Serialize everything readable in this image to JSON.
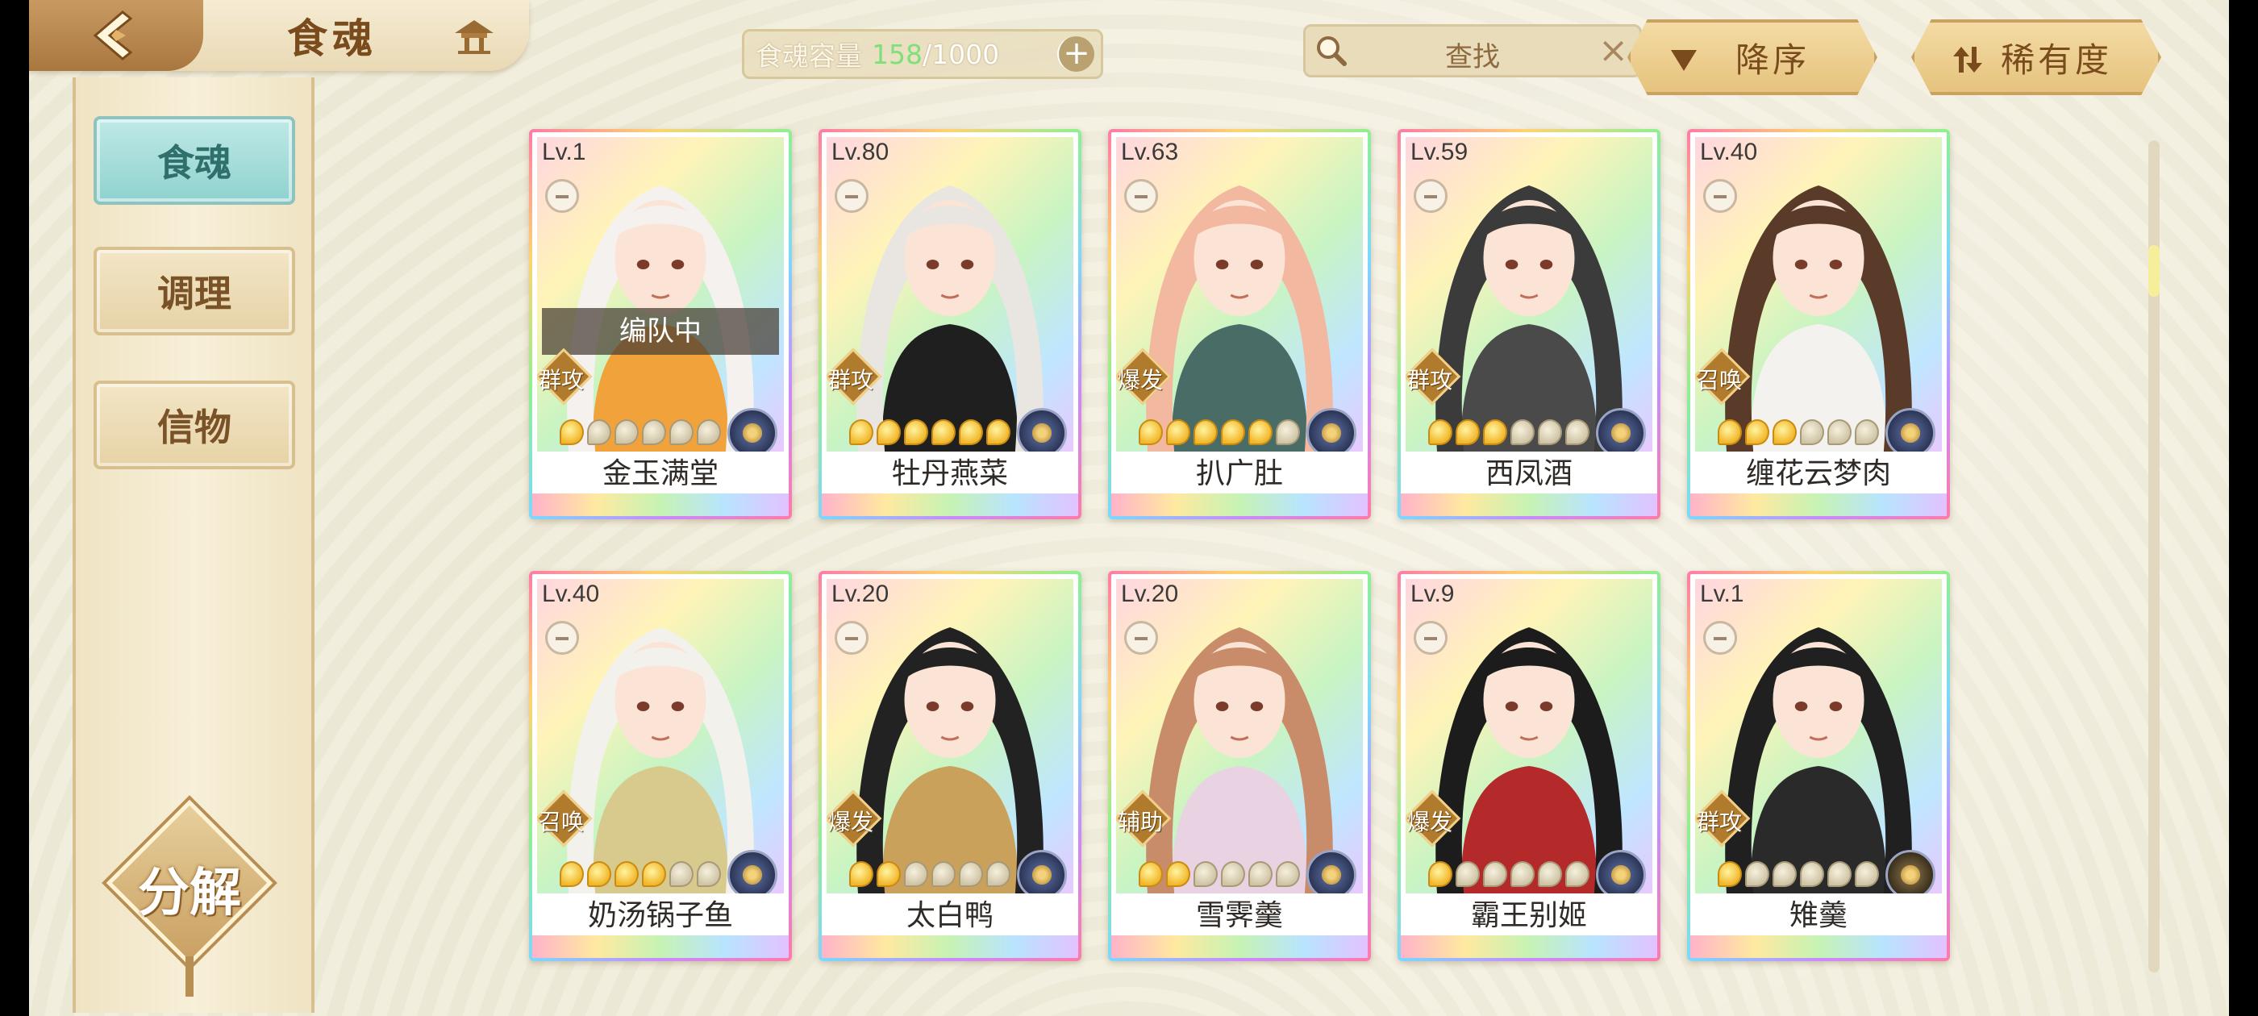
{
  "header": {
    "title": "食魂",
    "capacity": {
      "label": "食魂容量",
      "current": "158",
      "max": "/1000"
    },
    "search": {
      "placeholder": "查找"
    },
    "sort_label": "降序",
    "rarity_label": "稀有度"
  },
  "sidebar": {
    "items": [
      {
        "label": "食魂",
        "active": true
      },
      {
        "label": "调理",
        "active": false
      },
      {
        "label": "信物",
        "active": false
      }
    ],
    "decompose_label": "分解"
  },
  "cards": [
    {
      "level": "Lv.1",
      "name": "金玉满堂",
      "role": "群攻",
      "stars": 1,
      "team_status": "编队中",
      "hair": "#f4f1ef",
      "robe": "#f2a23a",
      "elem": "blue"
    },
    {
      "level": "Lv.80",
      "name": "牡丹燕菜",
      "role": "群攻",
      "stars": 6,
      "team_status": "",
      "hair": "#e9e6e2",
      "robe": "#1f1f1f",
      "elem": "blue"
    },
    {
      "level": "Lv.63",
      "name": "扒广肚",
      "role": "爆发",
      "stars": 5,
      "team_status": "",
      "hair": "#f2b8a0",
      "robe": "#4a6c66",
      "elem": "blue"
    },
    {
      "level": "Lv.59",
      "name": "西凤酒",
      "role": "群攻",
      "stars": 3,
      "team_status": "",
      "hair": "#3b3b3b",
      "robe": "#4a4a4a",
      "elem": "blue"
    },
    {
      "level": "Lv.40",
      "name": "缠花云梦肉",
      "role": "召唤",
      "stars": 3,
      "team_status": "",
      "hair": "#5a3a28",
      "robe": "#f4f2ee",
      "elem": "blue"
    },
    {
      "level": "Lv.40",
      "name": "奶汤锅子鱼",
      "role": "召唤",
      "stars": 4,
      "team_status": "",
      "hair": "#f2f1ec",
      "robe": "#d8c98c",
      "elem": "blue"
    },
    {
      "level": "Lv.20",
      "name": "太白鸭",
      "role": "爆发",
      "stars": 2,
      "team_status": "",
      "hair": "#222222",
      "robe": "#c9a15a",
      "elem": "blue"
    },
    {
      "level": "Lv.20",
      "name": "雪霁羹",
      "role": "辅助",
      "stars": 2,
      "team_status": "",
      "hair": "#c98c6a",
      "robe": "#e9d2e2",
      "elem": "blue"
    },
    {
      "level": "Lv.9",
      "name": "霸王别姬",
      "role": "爆发",
      "stars": 1,
      "team_status": "",
      "hair": "#1c1c1c",
      "robe": "#b42a2a",
      "elem": "blue"
    },
    {
      "level": "Lv.1",
      "name": "雉羹",
      "role": "群攻",
      "stars": 1,
      "team_status": "",
      "hair": "#202020",
      "robe": "#2a2a2a",
      "elem": "gold"
    }
  ]
}
